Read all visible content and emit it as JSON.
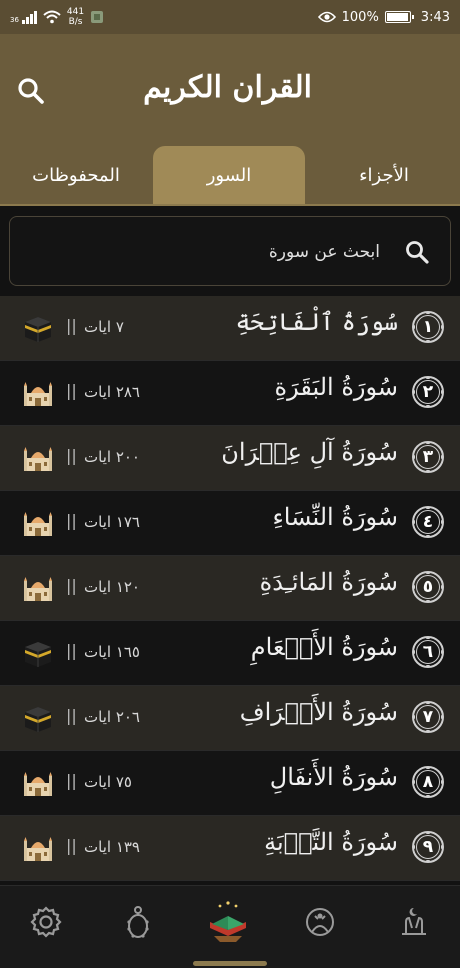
{
  "status_bar": {
    "signal": "36",
    "net_speed_value": "441",
    "net_speed_unit": "B/s",
    "battery": "100%",
    "battery_level": 1.0,
    "time": "3:43"
  },
  "header": {
    "title": "القران الكريم",
    "search_icon": "search-icon"
  },
  "tabs": [
    {
      "label": "الأجزاء",
      "active": false
    },
    {
      "label": "السور",
      "active": true
    },
    {
      "label": "المحفوظات",
      "active": false
    }
  ],
  "search": {
    "placeholder": "ابحث عن سورة"
  },
  "surahs": [
    {
      "number": "١",
      "name": "سُورَةُ ٱلْفَاتِحَةِ",
      "ayahs": "٧ ايات",
      "separator": "||",
      "place": "kaaba-icon"
    },
    {
      "number": "٢",
      "name": "سُورَةُ البَقَرَةِ",
      "ayahs": "٢٨٦ ايات",
      "separator": "||",
      "place": "mosque-icon"
    },
    {
      "number": "٣",
      "name": "سُورَةُ آلِ عِمۡرَانَ",
      "ayahs": "٢٠٠ ايات",
      "separator": "||",
      "place": "mosque-icon"
    },
    {
      "number": "٤",
      "name": "سُورَةُ النِّسَاءِ",
      "ayahs": "١٧٦ ايات",
      "separator": "||",
      "place": "mosque-icon"
    },
    {
      "number": "٥",
      "name": "سُورَةُ المَائـِدَةِ",
      "ayahs": "١٢٠ ايات",
      "separator": "||",
      "place": "mosque-icon"
    },
    {
      "number": "٦",
      "name": "سُورَةُ الأَنۡعَامِ",
      "ayahs": "١٦٥ ايات",
      "separator": "||",
      "place": "kaaba-icon"
    },
    {
      "number": "٧",
      "name": "سُورَةُ الأَعۡرَافِ",
      "ayahs": "٢٠٦ ايات",
      "separator": "||",
      "place": "kaaba-icon"
    },
    {
      "number": "٨",
      "name": "سُورَةُ الأَنفَالِ",
      "ayahs": "٧٥ ايات",
      "separator": "||",
      "place": "mosque-icon"
    },
    {
      "number": "٩",
      "name": "سُورَةُ التَّوۡبَةِ",
      "ayahs": "١٣٩ ايات",
      "separator": "||",
      "place": "mosque-icon"
    }
  ],
  "bottom_nav": [
    {
      "name": "settings-icon"
    },
    {
      "name": "prayer-beads-icon"
    },
    {
      "name": "quran-icon",
      "active": true
    },
    {
      "name": "prayer-time-icon"
    },
    {
      "name": "dua-hands-icon"
    }
  ],
  "colors": {
    "header_bg": "#6b5c3c",
    "active_tab": "#a08a57",
    "row_odd": "#2a2823",
    "row_even": "#141414",
    "accent": "#8c7a4e"
  }
}
